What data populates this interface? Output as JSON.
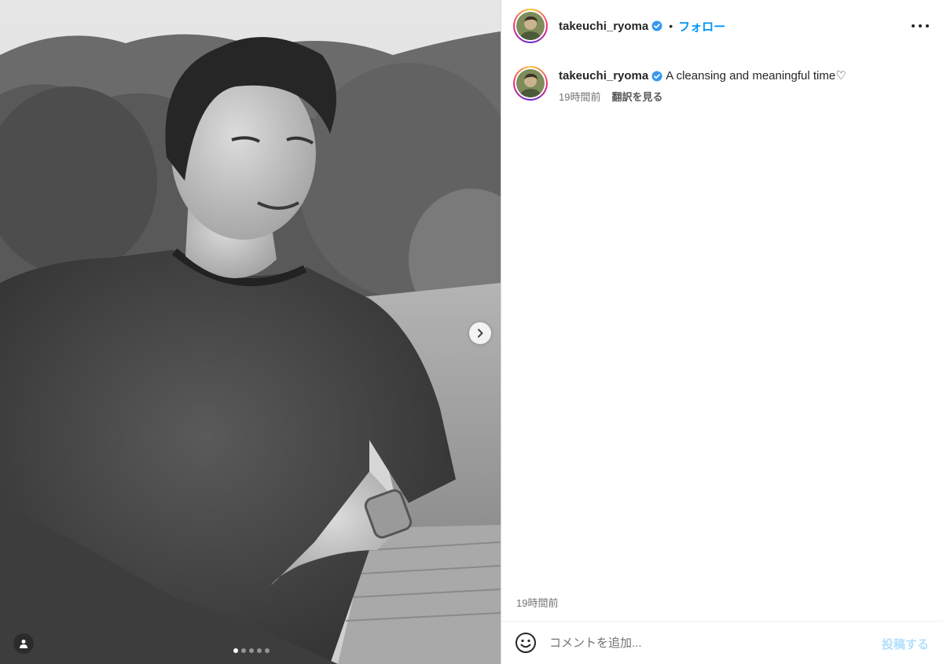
{
  "media": {
    "alt": "Black and white photo of a smiling man in a t-shirt sitting outdoors",
    "carousel_count": 5,
    "carousel_active": 1,
    "icons": {
      "next": "chevron-right-icon",
      "tags": "user-tag-icon"
    }
  },
  "header": {
    "username": "takeuchi_ryoma",
    "separator": "•",
    "follow_label": "フォロー",
    "icons": {
      "verified": "verified-badge-icon",
      "more": "more-options-icon"
    }
  },
  "caption": {
    "username": "takeuchi_ryoma",
    "text": "A cleansing and meaningful time♡",
    "time_ago": "19時間前",
    "translate_label": "翻訳を見る"
  },
  "footer": {
    "timestamp": "19時間前",
    "comment_placeholder": "コメントを追加...",
    "post_label": "投稿する",
    "icons": {
      "emoji": "emoji-icon"
    }
  },
  "colors": {
    "accent": "#0095f6",
    "post_disabled": "#b2dffc",
    "verified": "#3897f0",
    "muted_text": "#737373",
    "divider": "#dbdbdb"
  }
}
